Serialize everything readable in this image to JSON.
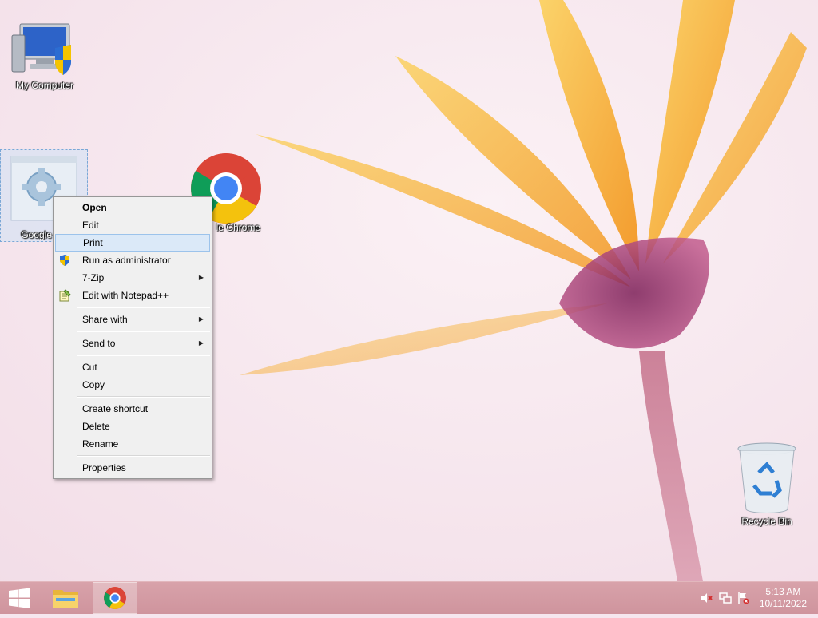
{
  "desktop": {
    "icons": [
      {
        "label": "My Computer"
      },
      {
        "label": "Google Ch"
      },
      {
        "label": "le Chrome"
      },
      {
        "label": "Recycle Bin"
      }
    ]
  },
  "context_menu": {
    "items": [
      {
        "label": "Open"
      },
      {
        "label": "Edit"
      },
      {
        "label": "Print"
      },
      {
        "label": "Run as administrator",
        "icon": "uac-shield-icon"
      },
      {
        "label": "7-Zip"
      },
      {
        "label": "Edit with Notepad++",
        "icon": "notepad-plus-plus-icon"
      },
      {
        "label": "Share with"
      },
      {
        "label": "Send to"
      },
      {
        "label": "Cut"
      },
      {
        "label": "Copy"
      },
      {
        "label": "Create shortcut"
      },
      {
        "label": "Delete"
      },
      {
        "label": "Rename"
      },
      {
        "label": "Properties"
      }
    ],
    "hovered": "Print"
  },
  "taskbar": {
    "pinned": [
      "windows-start-icon",
      "file-explorer-icon",
      "google-chrome-icon"
    ],
    "tray_icons": [
      "speaker-muted-icon",
      "network-icon",
      "action-center-flag-icon"
    ],
    "clock": {
      "time": "5:13 AM",
      "date": "10/11/2022"
    }
  },
  "colors": {
    "taskbar": "#d39aa3",
    "menu_hover": "#dbe9f8",
    "menu_bg": "#f0f0f0"
  }
}
